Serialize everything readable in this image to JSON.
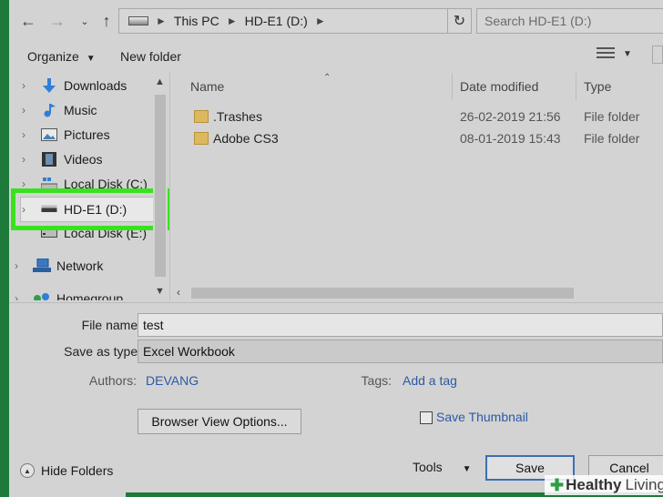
{
  "address": {
    "crumbs": [
      "This PC",
      "HD-E1 (D:)"
    ],
    "search_placeholder": "Search HD-E1 (D:)"
  },
  "toolbar": {
    "organize_label": "Organize",
    "new_folder_label": "New folder"
  },
  "sidebar": {
    "items": [
      {
        "label": "Downloads",
        "icon": "download-arrow-icon"
      },
      {
        "label": "Music",
        "icon": "music-note-icon"
      },
      {
        "label": "Pictures",
        "icon": "pictures-icon"
      },
      {
        "label": "Videos",
        "icon": "film-strip-icon"
      },
      {
        "label": "Local Disk (C:)",
        "icon": "windows-drive-icon"
      },
      {
        "label": "HD-E1 (D:)",
        "icon": "drive-icon",
        "selected": true
      },
      {
        "label": "Local Disk (E:)",
        "icon": "drive-icon"
      },
      {
        "label": "Network",
        "icon": "network-icon"
      },
      {
        "label": "Homegroup",
        "icon": "homegroup-icon"
      }
    ]
  },
  "files": {
    "columns": [
      "Name",
      "Date modified",
      "Type"
    ],
    "rows": [
      {
        "name": ".Trashes",
        "date": "26-02-2019 21:56",
        "type": "File folder"
      },
      {
        "name": "Adobe CS3",
        "date": "08-01-2019 15:43",
        "type": "File folder"
      }
    ]
  },
  "form": {
    "file_name_label": "File name:",
    "file_name_value": "test",
    "save_type_label": "Save as type:",
    "save_type_value": "Excel Workbook",
    "authors_label": "Authors:",
    "authors_value": "DEVANG",
    "tags_label": "Tags:",
    "tags_value": "Add a tag",
    "browser_view_label": "Browser View Options...",
    "thumbnail_label": "Save Thumbnail",
    "hide_folders_label": "Hide Folders",
    "tools_label": "Tools",
    "save_label": "Save",
    "cancel_label": "Cancel"
  },
  "watermark": {
    "brand_a": "Healthy",
    "brand_b": "Living"
  },
  "colors": {
    "highlight": "#39e21f",
    "link": "#2b5aa6",
    "background": "#1e7a3a"
  }
}
